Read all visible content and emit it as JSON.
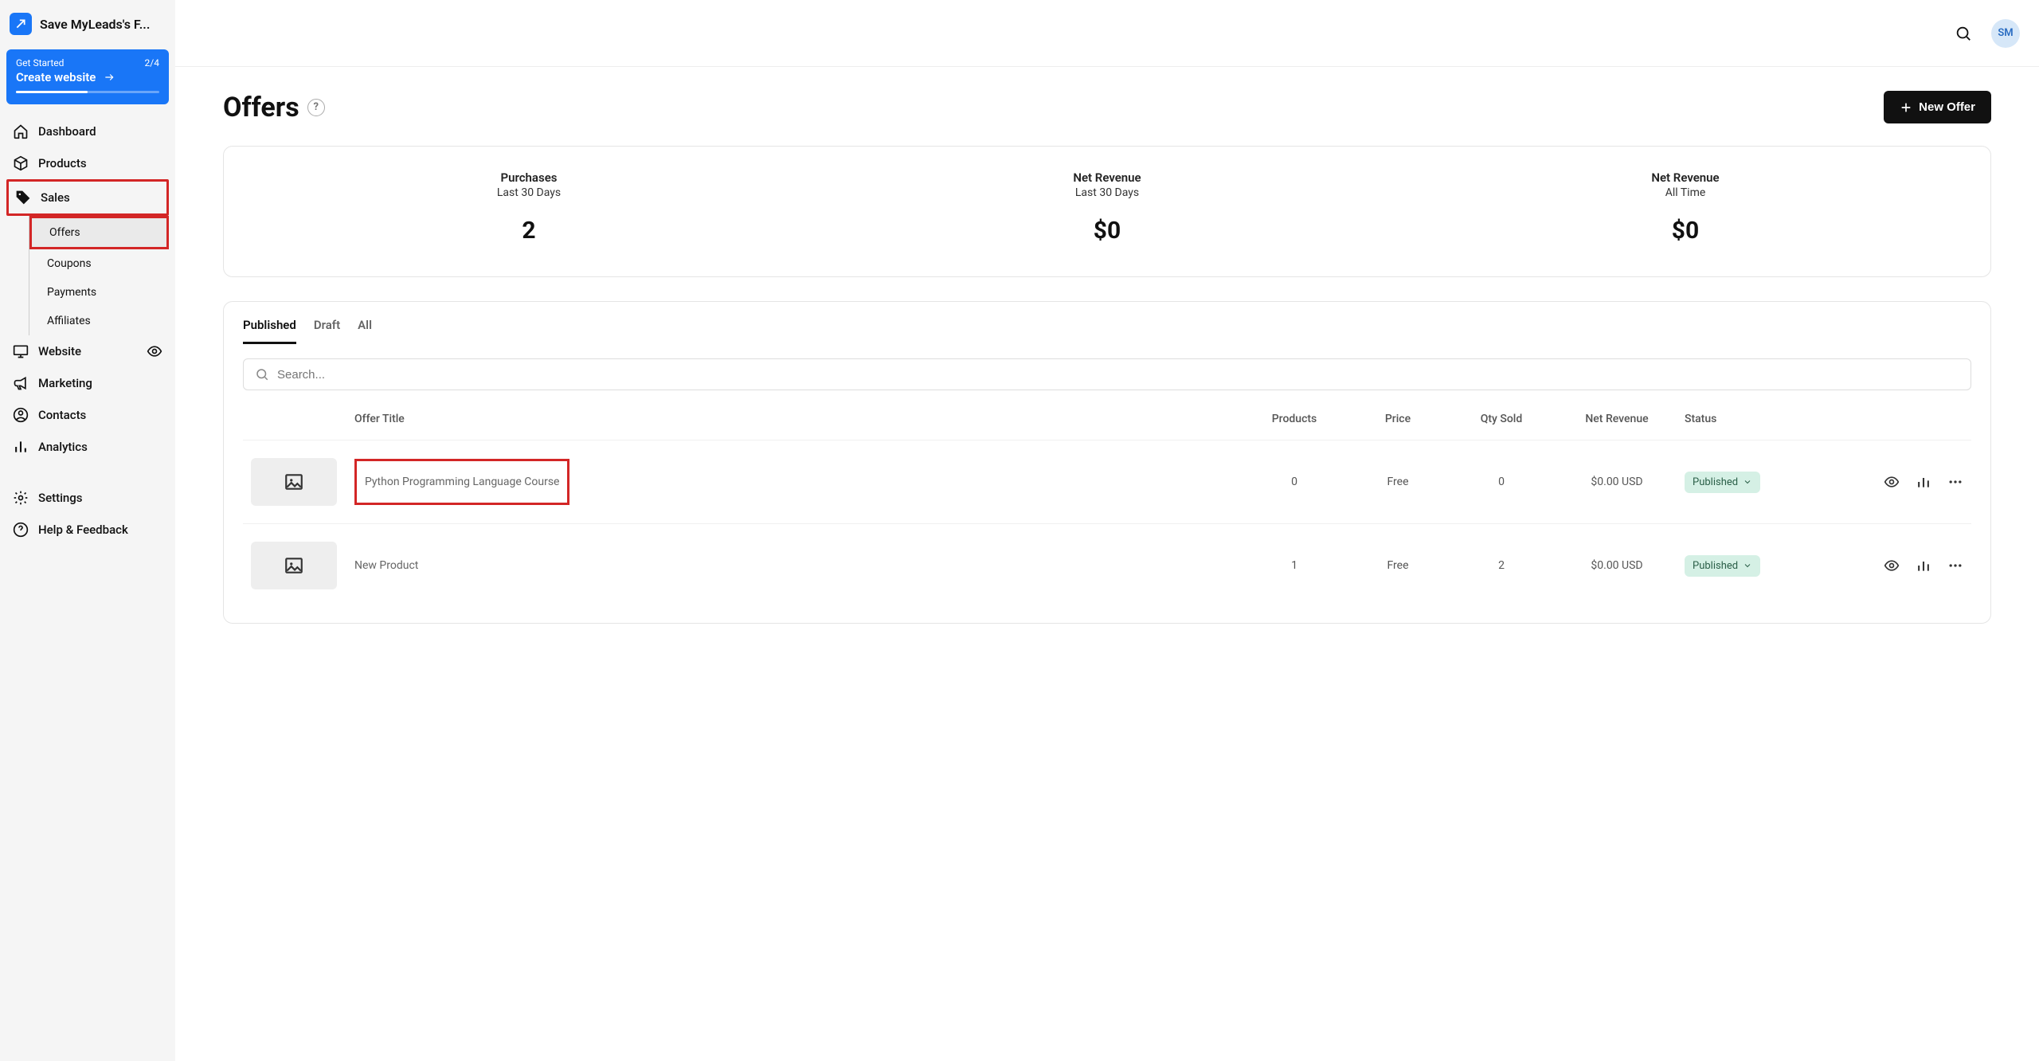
{
  "header": {
    "workspace_name": "Save MyLeads's F...",
    "avatar_initials": "SM"
  },
  "get_started": {
    "label": "Get Started",
    "progress": "2/4",
    "cta": "Create website"
  },
  "nav": {
    "dashboard": "Dashboard",
    "products": "Products",
    "sales": "Sales",
    "website": "Website",
    "marketing": "Marketing",
    "contacts": "Contacts",
    "analytics": "Analytics",
    "settings": "Settings",
    "help": "Help & Feedback"
  },
  "subnav": {
    "offers": "Offers",
    "coupons": "Coupons",
    "payments": "Payments",
    "affiliates": "Affiliates"
  },
  "page": {
    "title": "Offers",
    "new_offer": "New Offer"
  },
  "stats": [
    {
      "label": "Purchases",
      "sub": "Last 30 Days",
      "value": "2"
    },
    {
      "label": "Net Revenue",
      "sub": "Last 30 Days",
      "value": "$0"
    },
    {
      "label": "Net Revenue",
      "sub": "All Time",
      "value": "$0"
    }
  ],
  "tabs": {
    "published": "Published",
    "draft": "Draft",
    "all": "All"
  },
  "search": {
    "placeholder": "Search..."
  },
  "columns": {
    "title": "Offer Title",
    "products": "Products",
    "price": "Price",
    "qty": "Qty Sold",
    "revenue": "Net Revenue",
    "status": "Status"
  },
  "rows": [
    {
      "title": "Python Programming Language Course",
      "products": "0",
      "price": "Free",
      "qty": "0",
      "revenue": "$0.00 USD",
      "status": "Published",
      "highlight": true
    },
    {
      "title": "New Product",
      "products": "1",
      "price": "Free",
      "qty": "2",
      "revenue": "$0.00 USD",
      "status": "Published",
      "highlight": false
    }
  ]
}
